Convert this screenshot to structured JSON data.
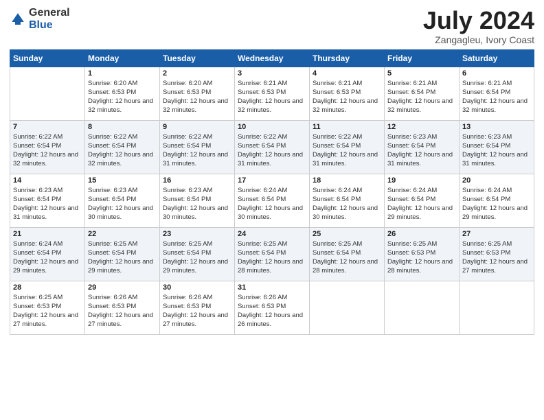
{
  "header": {
    "logo_general": "General",
    "logo_blue": "Blue",
    "title": "July 2024",
    "subtitle": "Zangagleu, Ivory Coast"
  },
  "weekdays": [
    "Sunday",
    "Monday",
    "Tuesday",
    "Wednesday",
    "Thursday",
    "Friday",
    "Saturday"
  ],
  "weeks": [
    [
      {
        "day": "",
        "sunrise": "",
        "sunset": "",
        "daylight": ""
      },
      {
        "day": "1",
        "sunrise": "Sunrise: 6:20 AM",
        "sunset": "Sunset: 6:53 PM",
        "daylight": "Daylight: 12 hours and 32 minutes."
      },
      {
        "day": "2",
        "sunrise": "Sunrise: 6:20 AM",
        "sunset": "Sunset: 6:53 PM",
        "daylight": "Daylight: 12 hours and 32 minutes."
      },
      {
        "day": "3",
        "sunrise": "Sunrise: 6:21 AM",
        "sunset": "Sunset: 6:53 PM",
        "daylight": "Daylight: 12 hours and 32 minutes."
      },
      {
        "day": "4",
        "sunrise": "Sunrise: 6:21 AM",
        "sunset": "Sunset: 6:53 PM",
        "daylight": "Daylight: 12 hours and 32 minutes."
      },
      {
        "day": "5",
        "sunrise": "Sunrise: 6:21 AM",
        "sunset": "Sunset: 6:54 PM",
        "daylight": "Daylight: 12 hours and 32 minutes."
      },
      {
        "day": "6",
        "sunrise": "Sunrise: 6:21 AM",
        "sunset": "Sunset: 6:54 PM",
        "daylight": "Daylight: 12 hours and 32 minutes."
      }
    ],
    [
      {
        "day": "7",
        "sunrise": "Sunrise: 6:22 AM",
        "sunset": "Sunset: 6:54 PM",
        "daylight": "Daylight: 12 hours and 32 minutes."
      },
      {
        "day": "8",
        "sunrise": "Sunrise: 6:22 AM",
        "sunset": "Sunset: 6:54 PM",
        "daylight": "Daylight: 12 hours and 32 minutes."
      },
      {
        "day": "9",
        "sunrise": "Sunrise: 6:22 AM",
        "sunset": "Sunset: 6:54 PM",
        "daylight": "Daylight: 12 hours and 31 minutes."
      },
      {
        "day": "10",
        "sunrise": "Sunrise: 6:22 AM",
        "sunset": "Sunset: 6:54 PM",
        "daylight": "Daylight: 12 hours and 31 minutes."
      },
      {
        "day": "11",
        "sunrise": "Sunrise: 6:22 AM",
        "sunset": "Sunset: 6:54 PM",
        "daylight": "Daylight: 12 hours and 31 minutes."
      },
      {
        "day": "12",
        "sunrise": "Sunrise: 6:23 AM",
        "sunset": "Sunset: 6:54 PM",
        "daylight": "Daylight: 12 hours and 31 minutes."
      },
      {
        "day": "13",
        "sunrise": "Sunrise: 6:23 AM",
        "sunset": "Sunset: 6:54 PM",
        "daylight": "Daylight: 12 hours and 31 minutes."
      }
    ],
    [
      {
        "day": "14",
        "sunrise": "Sunrise: 6:23 AM",
        "sunset": "Sunset: 6:54 PM",
        "daylight": "Daylight: 12 hours and 31 minutes."
      },
      {
        "day": "15",
        "sunrise": "Sunrise: 6:23 AM",
        "sunset": "Sunset: 6:54 PM",
        "daylight": "Daylight: 12 hours and 30 minutes."
      },
      {
        "day": "16",
        "sunrise": "Sunrise: 6:23 AM",
        "sunset": "Sunset: 6:54 PM",
        "daylight": "Daylight: 12 hours and 30 minutes."
      },
      {
        "day": "17",
        "sunrise": "Sunrise: 6:24 AM",
        "sunset": "Sunset: 6:54 PM",
        "daylight": "Daylight: 12 hours and 30 minutes."
      },
      {
        "day": "18",
        "sunrise": "Sunrise: 6:24 AM",
        "sunset": "Sunset: 6:54 PM",
        "daylight": "Daylight: 12 hours and 30 minutes."
      },
      {
        "day": "19",
        "sunrise": "Sunrise: 6:24 AM",
        "sunset": "Sunset: 6:54 PM",
        "daylight": "Daylight: 12 hours and 29 minutes."
      },
      {
        "day": "20",
        "sunrise": "Sunrise: 6:24 AM",
        "sunset": "Sunset: 6:54 PM",
        "daylight": "Daylight: 12 hours and 29 minutes."
      }
    ],
    [
      {
        "day": "21",
        "sunrise": "Sunrise: 6:24 AM",
        "sunset": "Sunset: 6:54 PM",
        "daylight": "Daylight: 12 hours and 29 minutes."
      },
      {
        "day": "22",
        "sunrise": "Sunrise: 6:25 AM",
        "sunset": "Sunset: 6:54 PM",
        "daylight": "Daylight: 12 hours and 29 minutes."
      },
      {
        "day": "23",
        "sunrise": "Sunrise: 6:25 AM",
        "sunset": "Sunset: 6:54 PM",
        "daylight": "Daylight: 12 hours and 29 minutes."
      },
      {
        "day": "24",
        "sunrise": "Sunrise: 6:25 AM",
        "sunset": "Sunset: 6:54 PM",
        "daylight": "Daylight: 12 hours and 28 minutes."
      },
      {
        "day": "25",
        "sunrise": "Sunrise: 6:25 AM",
        "sunset": "Sunset: 6:54 PM",
        "daylight": "Daylight: 12 hours and 28 minutes."
      },
      {
        "day": "26",
        "sunrise": "Sunrise: 6:25 AM",
        "sunset": "Sunset: 6:53 PM",
        "daylight": "Daylight: 12 hours and 28 minutes."
      },
      {
        "day": "27",
        "sunrise": "Sunrise: 6:25 AM",
        "sunset": "Sunset: 6:53 PM",
        "daylight": "Daylight: 12 hours and 27 minutes."
      }
    ],
    [
      {
        "day": "28",
        "sunrise": "Sunrise: 6:25 AM",
        "sunset": "Sunset: 6:53 PM",
        "daylight": "Daylight: 12 hours and 27 minutes."
      },
      {
        "day": "29",
        "sunrise": "Sunrise: 6:26 AM",
        "sunset": "Sunset: 6:53 PM",
        "daylight": "Daylight: 12 hours and 27 minutes."
      },
      {
        "day": "30",
        "sunrise": "Sunrise: 6:26 AM",
        "sunset": "Sunset: 6:53 PM",
        "daylight": "Daylight: 12 hours and 27 minutes."
      },
      {
        "day": "31",
        "sunrise": "Sunrise: 6:26 AM",
        "sunset": "Sunset: 6:53 PM",
        "daylight": "Daylight: 12 hours and 26 minutes."
      },
      {
        "day": "",
        "sunrise": "",
        "sunset": "",
        "daylight": ""
      },
      {
        "day": "",
        "sunrise": "",
        "sunset": "",
        "daylight": ""
      },
      {
        "day": "",
        "sunrise": "",
        "sunset": "",
        "daylight": ""
      }
    ]
  ]
}
